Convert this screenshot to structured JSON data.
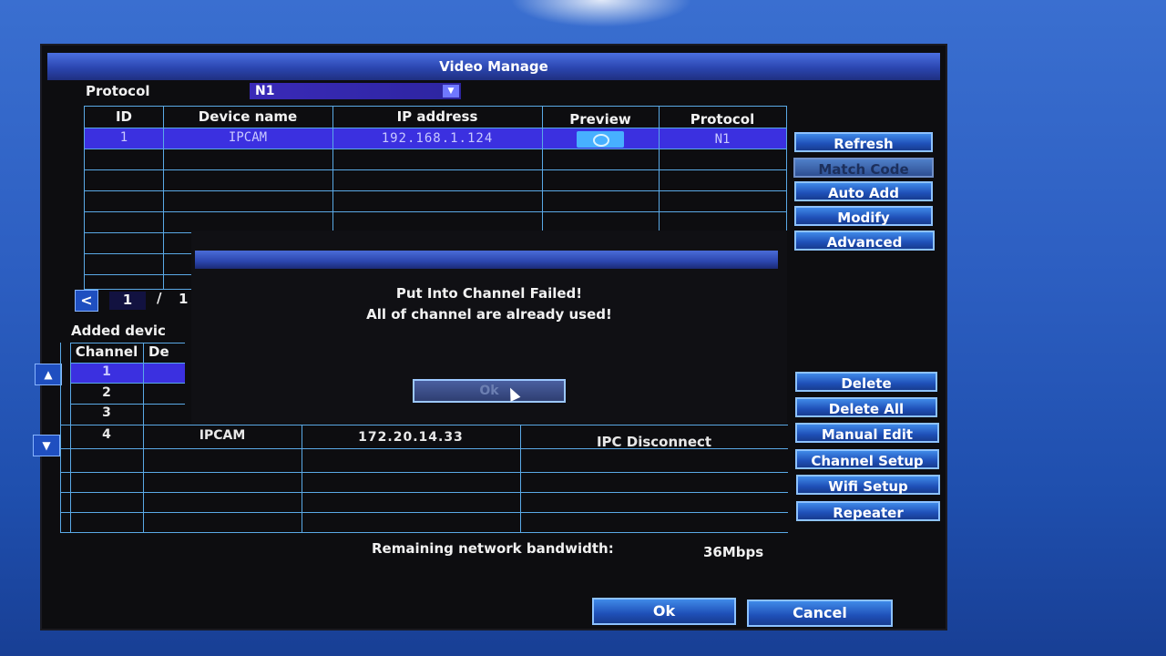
{
  "window": {
    "title": "Video Manage"
  },
  "protocol": {
    "label": "Protocol",
    "value": "N1"
  },
  "device_table": {
    "headers": [
      "ID",
      "Device name",
      "IP address",
      "Preview",
      "Protocol"
    ],
    "rows": [
      {
        "id": "1",
        "name": "IPCAM",
        "ip": "192.168.1.124",
        "protocol": "N1"
      }
    ]
  },
  "pagination": {
    "current": "1",
    "separator": "/",
    "total": "1"
  },
  "right_buttons_top": {
    "refresh": "Refresh",
    "match_code": "Match Code",
    "auto_add": "Auto Add",
    "modify": "Modify",
    "advanced": "Advanced"
  },
  "added_devices": {
    "label": "Added devic",
    "headers": {
      "channel": "Channel",
      "device": "De"
    },
    "rows": [
      {
        "channel": "1",
        "name": "",
        "ip": "",
        "status": ""
      },
      {
        "channel": "2",
        "name": "",
        "ip": "",
        "status": ""
      },
      {
        "channel": "3",
        "name": "",
        "ip": "",
        "status": ""
      },
      {
        "channel": "4",
        "name": "IPCAM",
        "ip": "172.20.14.33",
        "status": "IPC Disconnect"
      }
    ]
  },
  "right_buttons_bottom": {
    "delete": "Delete",
    "delete_all": "Delete All",
    "manual_edit": "Manual Edit",
    "channel_setup": "Channel Setup",
    "wifi_setup": "Wifi Setup",
    "repeater": "Repeater"
  },
  "bandwidth": {
    "label": "Remaining network bandwidth:",
    "value": "36Mbps"
  },
  "footer": {
    "ok": "Ok",
    "cancel": "Cancel"
  },
  "dialog": {
    "line1": "Put Into Channel Failed!",
    "line2": "All of channel are already used!",
    "ok": "Ok"
  },
  "icons": {
    "up": "up-arrow-icon",
    "down": "down-arrow-icon",
    "prev": "chevron-left-icon"
  }
}
